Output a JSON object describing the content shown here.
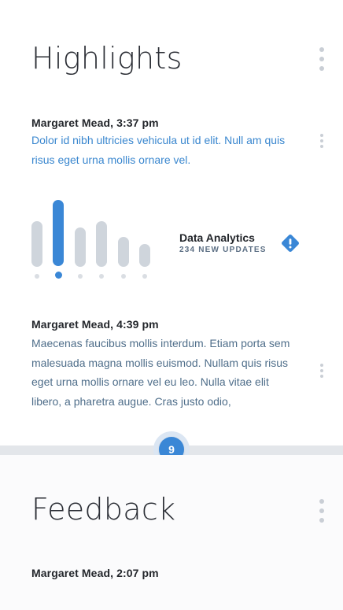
{
  "highlights": {
    "title": "Highlights",
    "posts": [
      {
        "author": "Margaret Mead, 3:37 pm",
        "text": "Dolor id nibh ultricies vehicula ut id elit. Null am quis risus eget urna mollis ornare vel."
      },
      {
        "author": "Margaret Mead, 4:39 pm",
        "text": "Maecenas faucibus mollis interdum. Etiam porta sem malesuada magna mollis euismod. Nullam quis risus eget urna mollis ornare vel eu leo. Nulla vitae elit libero, a pharetra augue. Cras justo odio,"
      }
    ],
    "analytics": {
      "title": "Data Analytics",
      "subtitle": "234 NEW UPDATES",
      "icon": "alert-diamond-icon",
      "bar_levels": [
        0.58,
        0.84,
        0.5,
        0.58,
        0.38,
        0.29
      ],
      "active_index": 1
    }
  },
  "badge": {
    "count": "9"
  },
  "feedback": {
    "title": "Feedback",
    "posts": [
      {
        "author": "Margaret Mead, 2:07 pm"
      }
    ]
  },
  "colors": {
    "accent": "#3a87d6",
    "bar_inactive": "#cfd5dc",
    "link_text": "#3a87cf",
    "body_text": "#4f6e8a"
  }
}
